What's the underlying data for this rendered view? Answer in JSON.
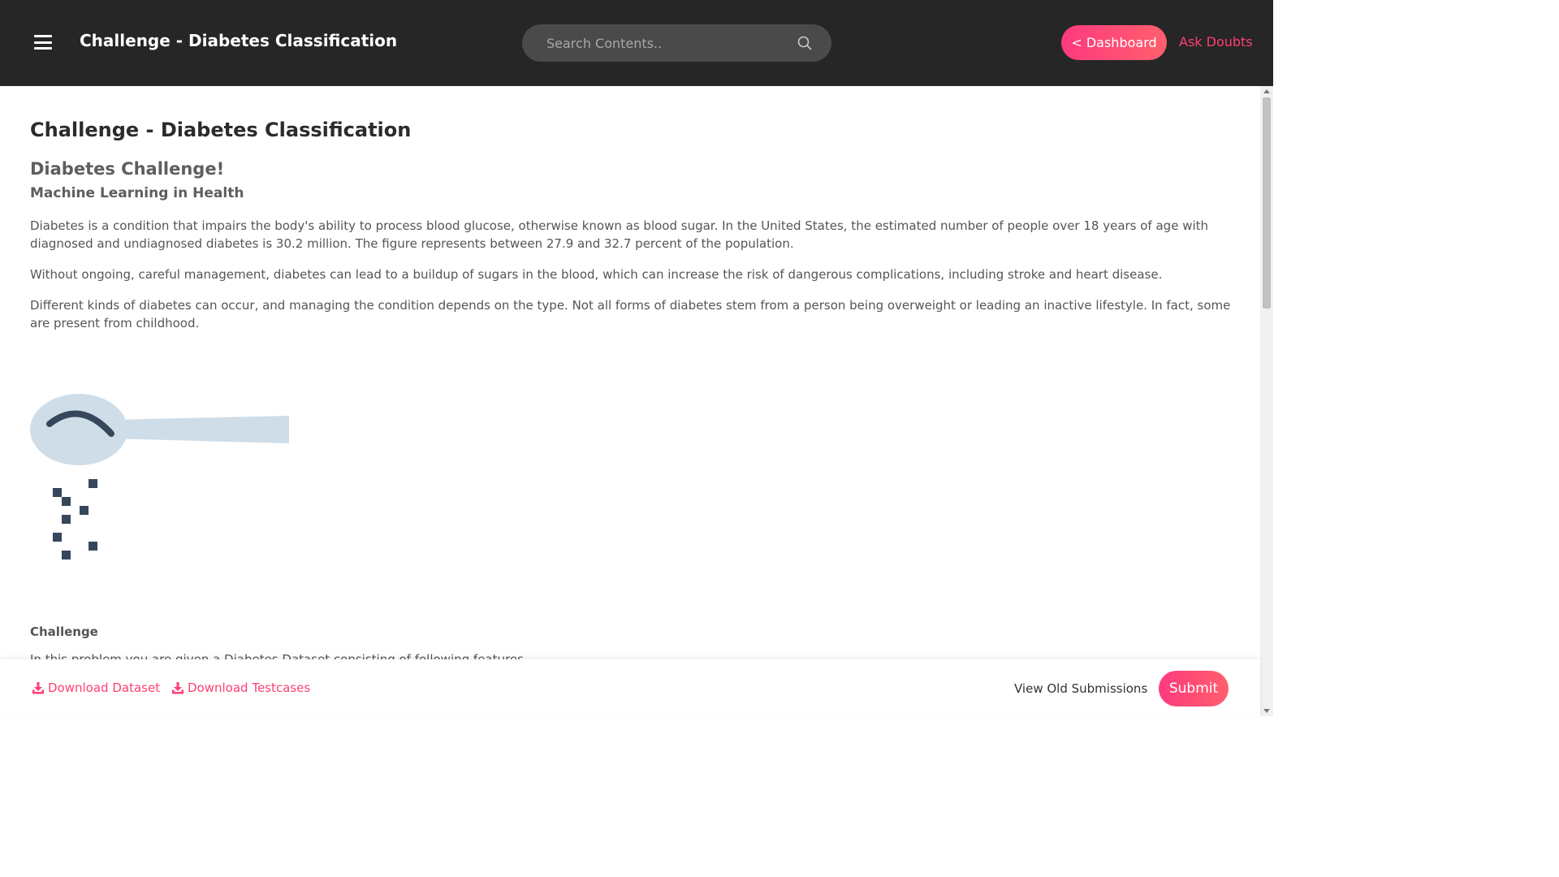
{
  "header": {
    "title": "Challenge - Diabetes Classification",
    "search_placeholder": "Search Contents..",
    "dashboard_label": "< Dashboard",
    "ask_doubts_label": "Ask Doubts"
  },
  "main": {
    "page_title": "Challenge - Diabetes Classification",
    "heading": "Diabetes Challenge!",
    "subheading": "Machine Learning in Health",
    "paragraphs": [
      "Diabetes is a condition that impairs the body's ability to process blood glucose, otherwise known as blood sugar. In the United States, the estimated number of people over 18 years of age with diagnosed and undiagnosed diabetes is 30.2 million. The figure represents between 27.9 and 32.7 percent of the population.",
      "Without ongoing, careful management, diabetes can lead to a buildup of sugars in the blood, which can increase the risk of dangerous complications, including stroke and heart disease.",
      "Different kinds of diabetes can occur, and managing the condition depends on the type. Not all forms of diabetes stem from a person being overweight or leading an inactive lifestyle. In fact, some are present from childhood."
    ],
    "section_heading": "Challenge",
    "cut_paragraph": "In this problem you are given a Diabetes Dataset consisting of following features"
  },
  "footer": {
    "download_dataset_label": "Download Dataset",
    "download_testcases_label": "Download Testcases",
    "view_old_label": "View Old Submissions",
    "submit_label": "Submit"
  },
  "icons": {
    "menu": "hamburger-menu-icon",
    "search": "search-icon",
    "download": "download-icon",
    "illustration": "sugar-spoon-illustration"
  },
  "colors": {
    "topbar": "#262626",
    "accent": "#ff3f73",
    "spoon": "#cfdde8",
    "sugar": "#36475c"
  }
}
